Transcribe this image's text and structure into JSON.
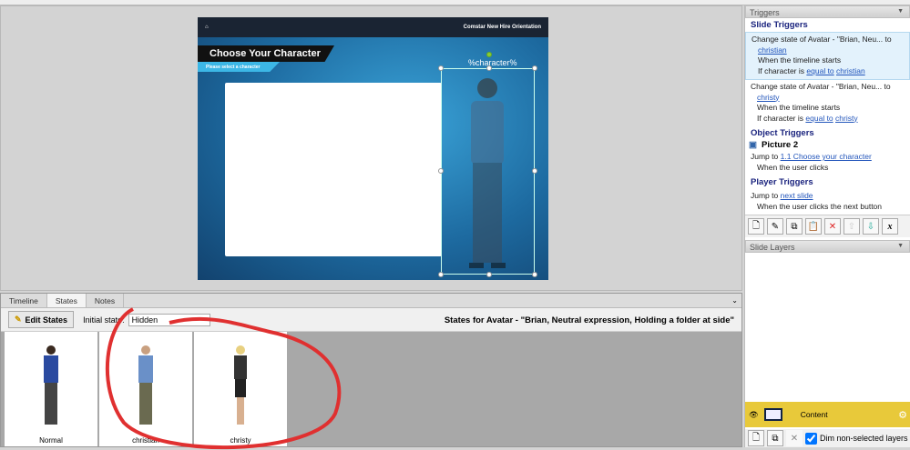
{
  "slide": {
    "header_title": "Comstar New Hire Orientation",
    "title": "Choose Your Character",
    "subtitle": "Please select a character",
    "variable_text": "%character%"
  },
  "bottom_panel": {
    "tabs": [
      "Timeline",
      "States",
      "Notes"
    ],
    "active_tab": "States",
    "edit_states_label": "Edit States",
    "initial_state_label": "Initial state:",
    "initial_state_value": "Hidden",
    "states_title": "States for Avatar - \"Brian, Neutral expression, Holding a folder at side\"",
    "states": [
      {
        "label": "Normal"
      },
      {
        "label": "christian"
      },
      {
        "label": "christy"
      }
    ]
  },
  "triggers": {
    "panel_title": "Triggers",
    "slide_section": "Slide Triggers",
    "slide_triggers": [
      {
        "action": "Change state of Avatar - \"Brian, Neu... to",
        "target": "christian",
        "when": "When the timeline starts",
        "cond_prefix": "If character is",
        "cond_op": "equal to",
        "cond_value": "christian"
      },
      {
        "action": "Change state of Avatar - \"Brian, Neu... to",
        "target": "christy",
        "when": "When the timeline starts",
        "cond_prefix": "If character is",
        "cond_op": "equal to",
        "cond_value": "christy"
      }
    ],
    "object_section": "Object Triggers",
    "object_name": "Picture 2",
    "object_action": "Jump to",
    "object_target": "1.1 Choose your character",
    "object_when": "When the user clicks",
    "player_section": "Player Triggers",
    "player_action": "Jump to",
    "player_target": "next slide",
    "player_when": "When the user clicks the next button"
  },
  "layers": {
    "panel_title": "Slide Layers",
    "layer_name": "Content",
    "dim_label": "Dim non-selected layers",
    "dim_checked": true
  }
}
